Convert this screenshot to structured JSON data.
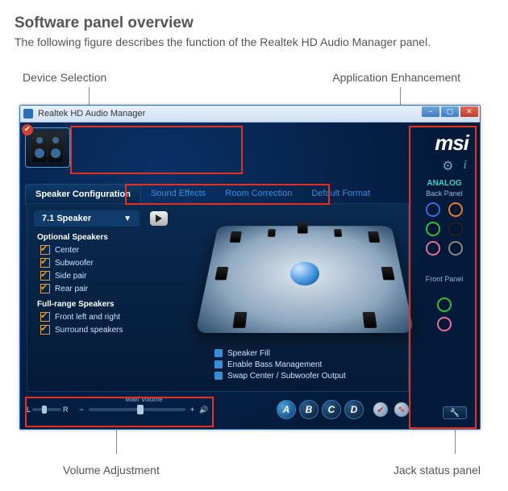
{
  "doc": {
    "heading": "Software panel overview",
    "intro": "The following figure describes the function of the Realtek HD Audio Manager panel."
  },
  "callouts": {
    "device_selection": "Device Selection",
    "app_enhancement": "Application Enhancement",
    "volume_adjustment": "Volume Adjustment",
    "jack_status": "Jack status panel"
  },
  "window": {
    "title": "Realtek HD Audio Manager",
    "brand": "msi",
    "gear_icon": "⚙",
    "info_icon": "i"
  },
  "tabs": {
    "speaker_config": "Speaker Configuration",
    "sound_effects": "Sound Effects",
    "room_correction": "Room Correction",
    "default_format": "Default Format"
  },
  "config": {
    "mode": "7.1 Speaker",
    "optional_h": "Optional Speakers",
    "center": "Center",
    "subwoofer": "Subwoofer",
    "side_pair": "Side pair",
    "rear_pair": "Rear pair",
    "fullrange_h": "Full-range Speakers",
    "front_lr": "Front left and right",
    "surround": "Surround speakers"
  },
  "options": {
    "speaker_fill": "Speaker Fill",
    "bass_mgmt": "Enable Bass Management",
    "swap": "Swap Center / Subwoofer Output"
  },
  "volume": {
    "l": "L",
    "r": "R",
    "minus": "−",
    "plus": "+",
    "speaker_glyph": "🔊",
    "main_label": "Main Volume"
  },
  "letters": {
    "a": "A",
    "b": "B",
    "c": "C",
    "d": "D"
  },
  "side_circles": {
    "check": "✔",
    "pencil": "✎"
  },
  "side_panel": {
    "analog": "ANALOG",
    "back": "Back Panel",
    "front": "Front Panel",
    "jack_colors": {
      "blue": "#3a6ae0",
      "orange": "#e08030",
      "green": "#30c040",
      "black": "#222",
      "pink": "#e070a0",
      "grey": "#8a8a8a"
    },
    "wrench": "🔧"
  }
}
